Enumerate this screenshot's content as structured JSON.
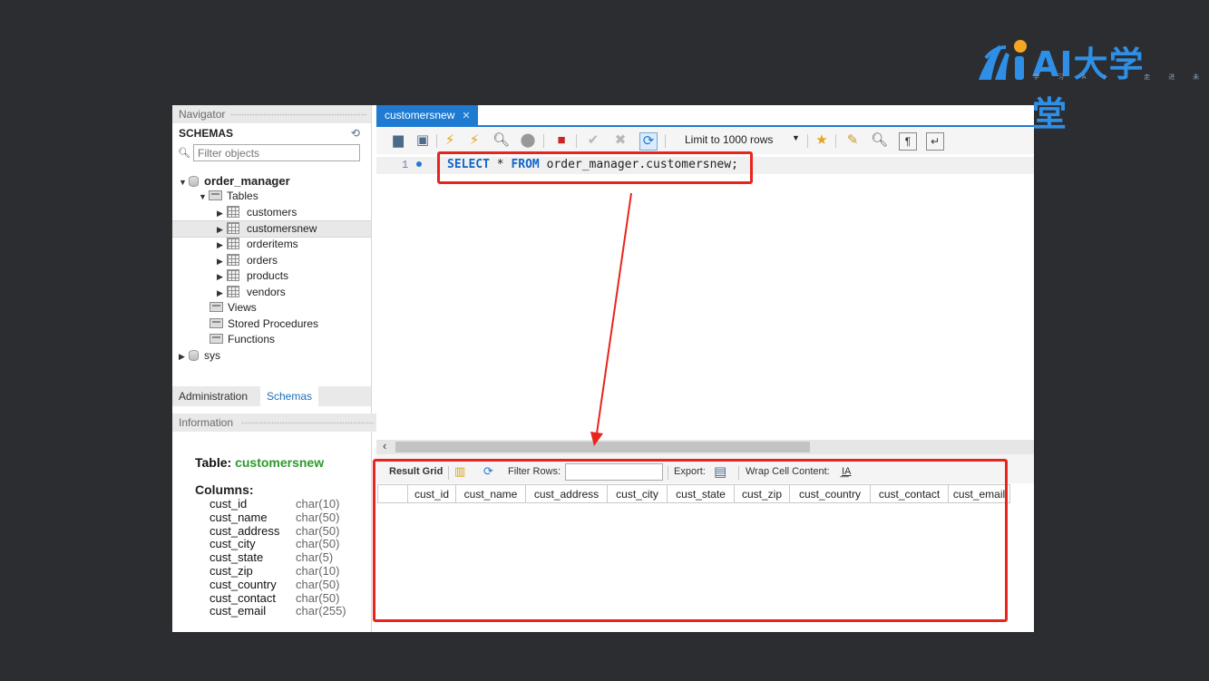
{
  "logo": {
    "title": "AI大学堂",
    "subtitle": "学 习 A I · 走 进 未 来"
  },
  "navigator": {
    "title": "Navigator",
    "schemas_label": "SCHEMAS",
    "filter_placeholder": "Filter objects",
    "tree": {
      "db1": "order_manager",
      "tables_label": "Tables",
      "tables": [
        "customers",
        "customersnew",
        "orderitems",
        "orders",
        "products",
        "vendors"
      ],
      "views_label": "Views",
      "procs_label": "Stored Procedures",
      "funcs_label": "Functions",
      "db2": "sys"
    },
    "tabs": {
      "admin": "Administration",
      "schemas": "Schemas"
    },
    "info_title": "Information"
  },
  "info": {
    "table_prefix": "Table: ",
    "table_name": "customersnew",
    "columns_label": "Columns:",
    "columns": [
      {
        "name": "cust_id",
        "type": "char(10)"
      },
      {
        "name": "cust_name",
        "type": "char(50)"
      },
      {
        "name": "cust_address",
        "type": "char(50)"
      },
      {
        "name": "cust_city",
        "type": "char(50)"
      },
      {
        "name": "cust_state",
        "type": "char(5)"
      },
      {
        "name": "cust_zip",
        "type": "char(10)"
      },
      {
        "name": "cust_country",
        "type": "char(50)"
      },
      {
        "name": "cust_contact",
        "type": "char(50)"
      },
      {
        "name": "cust_email",
        "type": "char(255)"
      }
    ]
  },
  "editor": {
    "tab_label": "customersnew",
    "limit_label": "Limit to 1000 rows",
    "line_number": "1",
    "sql": {
      "kw1": "SELECT",
      "star": " * ",
      "kw2": "FROM",
      "rest": " order_manager.customersnew;"
    }
  },
  "results": {
    "result_grid": "Result Grid",
    "filter_rows": "Filter Rows:",
    "export": "Export:",
    "wrap": "Wrap Cell Content:",
    "columns": [
      "cust_id",
      "cust_name",
      "cust_address",
      "cust_city",
      "cust_state",
      "cust_zip",
      "cust_country",
      "cust_contact",
      "cust_email"
    ]
  },
  "colors": {
    "accent": "#1f7ad2",
    "annotation": "#e8241c",
    "keyword": "#1264c9",
    "info_table": "#2a9a2a"
  }
}
